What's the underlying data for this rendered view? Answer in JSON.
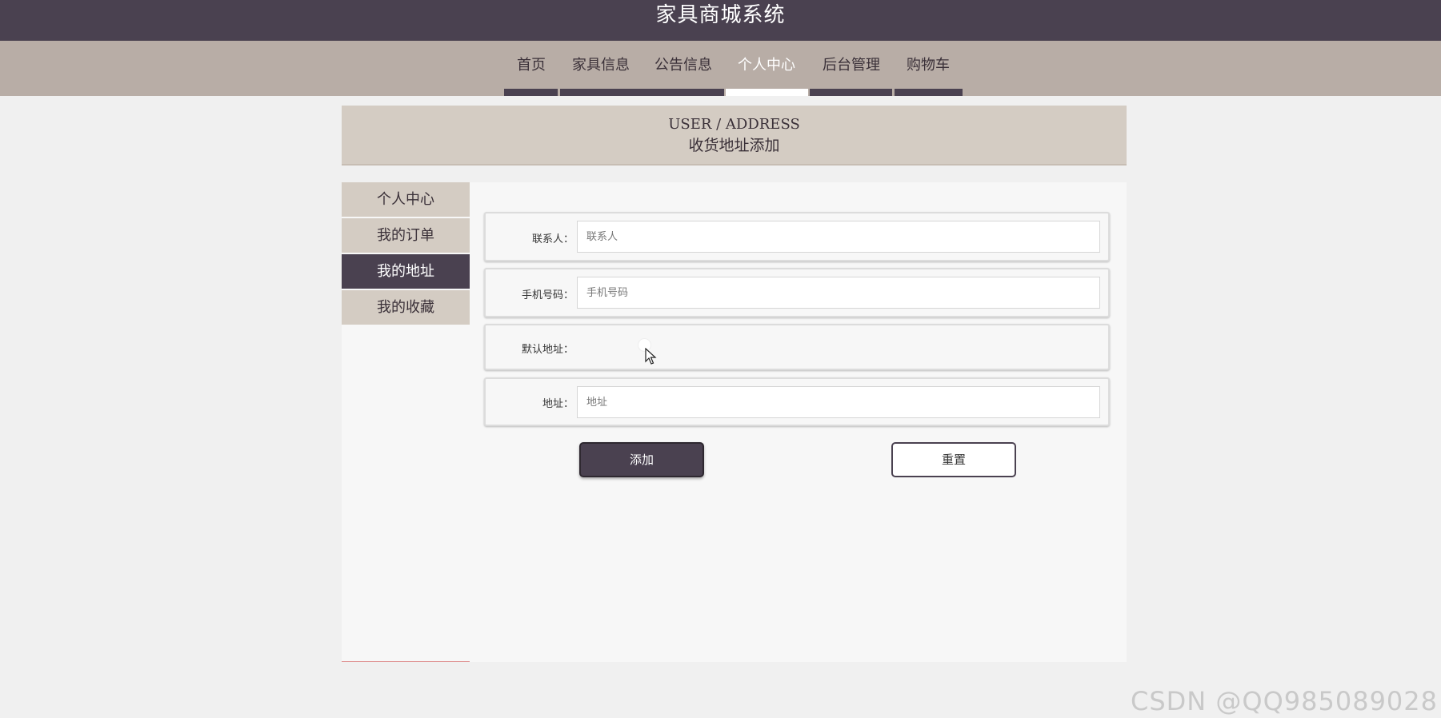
{
  "header": {
    "site_title": "家具商城系统"
  },
  "nav": {
    "items": [
      {
        "label": "首页"
      },
      {
        "label": "家具信息"
      },
      {
        "label": "公告信息"
      },
      {
        "label": "个人中心"
      },
      {
        "label": "后台管理"
      },
      {
        "label": "购物车"
      }
    ],
    "active": "个人中心"
  },
  "banner": {
    "title_en": "USER / ADDRESS",
    "title_cn": "收货地址添加"
  },
  "side_menu": {
    "items": [
      {
        "label": "个人中心"
      },
      {
        "label": "我的订单"
      },
      {
        "label": "我的地址"
      },
      {
        "label": "我的收藏"
      }
    ],
    "active": "我的地址"
  },
  "form": {
    "contact": {
      "label": "联系人：",
      "placeholder": "联系人",
      "value": ""
    },
    "phone": {
      "label": "手机号码：",
      "placeholder": "手机号码",
      "value": ""
    },
    "default_address": {
      "label": "默认地址：",
      "enabled": false
    },
    "address": {
      "label": "地址：",
      "placeholder": "地址",
      "value": ""
    }
  },
  "buttons": {
    "add_label": "添加",
    "reset_label": "重置"
  },
  "watermark": "CSDN @QQ985089028",
  "colors": {
    "primary": "#4a4150",
    "nav_bg": "#b8ada6",
    "banner_bg": "#d4ccc3",
    "page_bg": "#f0f0f0"
  }
}
